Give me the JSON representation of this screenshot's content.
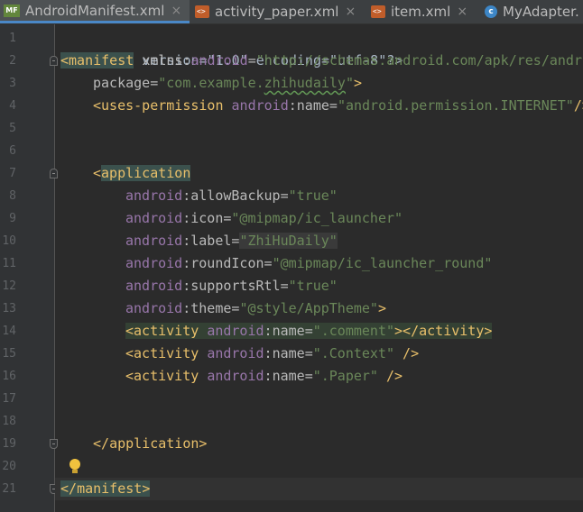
{
  "tabs": [
    {
      "label": "AndroidManifest.xml",
      "icon": "manifest-file-icon",
      "icon_text": "MF",
      "active": true
    },
    {
      "label": "activity_paper.xml",
      "icon": "xml-file-icon",
      "active": false
    },
    {
      "label": "item.xml",
      "icon": "xml-file-icon",
      "active": false
    },
    {
      "label": "MyAdapter.",
      "icon": "java-class-icon",
      "icon_text": "c",
      "active": false
    }
  ],
  "tab_close_glyph": "×",
  "line_numbers": [
    "1",
    "2",
    "3",
    "4",
    "5",
    "6",
    "7",
    "8",
    "9",
    "10",
    "11",
    "12",
    "13",
    "14",
    "15",
    "16",
    "17",
    "18",
    "19",
    "20",
    "21"
  ],
  "code": {
    "l1": {
      "text": "<?xml version=\"1.0\" encoding=\"utf-8\"?>"
    },
    "l2": {
      "open": "<",
      "tag": "manifest",
      "sp": " ",
      "a1": "xmlns",
      "colon": ":",
      "ns": "android",
      "eq": "=",
      "val": "\"http://schemas.android.com/apk/res/andro"
    },
    "l3": {
      "attr": "package",
      "eq": "=",
      "v1": "\"com.example.",
      "v2": "zhihudaily",
      "v3": "\"",
      "close": ">"
    },
    "l4": {
      "open": "<",
      "tag": "uses-permission",
      "sp": " ",
      "ns": "android",
      "colon": ":",
      "attr": "name",
      "eq": "=",
      "val": "\"android.permission.INTERNET\"",
      "close": "/>"
    },
    "l7": {
      "open": "<",
      "tag": "application"
    },
    "l8": {
      "ns": "android",
      "colon": ":",
      "attr": "allowBackup",
      "eq": "=",
      "val": "\"true\""
    },
    "l9": {
      "ns": "android",
      "colon": ":",
      "attr": "icon",
      "eq": "=",
      "val": "\"@mipmap/ic_launcher\""
    },
    "l10": {
      "ns": "android",
      "colon": ":",
      "attr": "label",
      "eq": "=",
      "val": "\"ZhiHuDaily\""
    },
    "l11": {
      "ns": "android",
      "colon": ":",
      "attr": "roundIcon",
      "eq": "=",
      "val": "\"@mipmap/ic_launcher_round\""
    },
    "l12": {
      "ns": "android",
      "colon": ":",
      "attr": "supportsRtl",
      "eq": "=",
      "val": "\"true\""
    },
    "l13": {
      "ns": "android",
      "colon": ":",
      "attr": "theme",
      "eq": "=",
      "val": "\"@style/AppTheme\"",
      "close": ">"
    },
    "l14": {
      "open": "<",
      "tag": "activity",
      "sp": " ",
      "ns": "android",
      "colon": ":",
      "attr": "name",
      "eq": "=",
      "val": "\".comment\"",
      "close": "></",
      "tag2": "activity",
      "end": ">"
    },
    "l15": {
      "open": "<",
      "tag": "activity",
      "sp": " ",
      "ns": "android",
      "colon": ":",
      "attr": "name",
      "eq": "=",
      "val": "\".Context\"",
      "close": " />"
    },
    "l16": {
      "open": "<",
      "tag": "activity",
      "sp": " ",
      "ns": "android",
      "colon": ":",
      "attr": "name",
      "eq": "=",
      "val": "\".Paper\"",
      "close": " />"
    },
    "l19": {
      "open": "</",
      "tag": "application",
      "close": ">"
    },
    "l21": {
      "open": "</",
      "tag": "manifest",
      "close": ">"
    }
  },
  "colors": {
    "background": "#2b2b2b",
    "gutter": "#313335",
    "tag": "#e8bf6a",
    "attribute": "#bababa",
    "namespace": "#9876aa",
    "string": "#6a8759",
    "text": "#a9b7c6",
    "line_number": "#606366"
  }
}
